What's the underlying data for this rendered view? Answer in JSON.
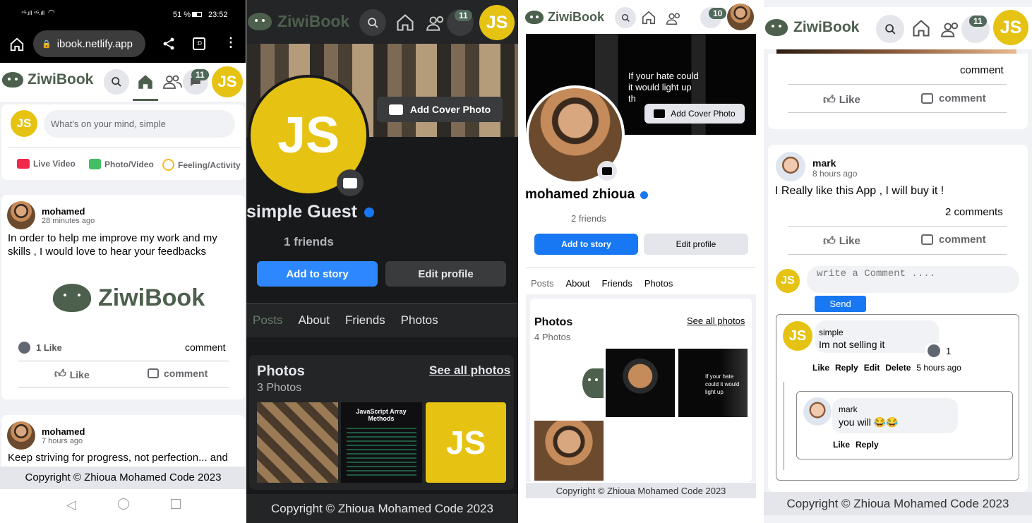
{
  "panel1": {
    "status": {
      "signal": "⁴ᴳ.ıll ⁴ᴳ.ıll",
      "battery": "51 %",
      "time": "23:52"
    },
    "browser": {
      "url": "ibook.netlify.app"
    },
    "nav": {
      "brand": "ZiwiBook",
      "badge": "11",
      "avatar": "JS"
    },
    "composer": {
      "avatar": "JS",
      "placeholder": "What's on your mind, simple",
      "live": "Live Video",
      "photo": "Photo/Video",
      "feeling": "Feeling/Activity"
    },
    "post1": {
      "author": "mohamed",
      "time": "28 minutes ago",
      "text": "In order to help me improve my work and my skills , I would love to hear your feedbacks",
      "image_brand": "ZiwiBook",
      "likes": "1 Like",
      "comment_link": "comment",
      "like_btn": "Like",
      "comment_btn": "comment"
    },
    "post2": {
      "author": "mohamed",
      "time": "7 hours ago",
      "text": "Keep striving for progress, not perfection... and"
    },
    "footer": "Copyright © Zhioua Mohamed Code 2023"
  },
  "panel2": {
    "nav": {
      "brand": "ZiwiBook",
      "badge": "11",
      "avatar": "JS"
    },
    "cover_btn": "Add Cover Photo",
    "profile_avatar": "JS",
    "name": "simple Guest",
    "friends": "1 friends",
    "add_story": "Add to story",
    "edit_profile": "Edit profile",
    "tabs": [
      "Posts",
      "About",
      "Friends",
      "Photos"
    ],
    "photos": {
      "title": "Photos",
      "count": "3 Photos",
      "see_all": "See all photos",
      "js_thumb": "JS",
      "code_title": "JavaScript Array Methods"
    },
    "footer": "Copyright © Zhioua Mohamed Code 2023"
  },
  "panel3": {
    "nav": {
      "brand": "ZiwiBook",
      "badge": "10"
    },
    "cover_btn": "Add Cover Photo",
    "cover_quote": "If your hate could it would light up th",
    "name": "mohamed zhioua",
    "friends": "2 friends",
    "add_story": "Add to story",
    "edit_profile": "Edit profile",
    "tabs": [
      "Posts",
      "About",
      "Friends",
      "Photos"
    ],
    "photos": {
      "title": "Photos",
      "count": "4 Photos",
      "see_all": "See all photos",
      "quote": "If your hate could it would light up"
    },
    "footer": "Copyright © Zhioua Mohamed Code 2023"
  },
  "panel4": {
    "nav": {
      "brand": "ZiwiBook",
      "badge": "11",
      "avatar": "JS"
    },
    "prev": {
      "comment_link": "comment",
      "like_btn": "Like",
      "comment_btn": "comment"
    },
    "post": {
      "author": "mark",
      "time": "8 hours ago",
      "text": "I Really like this App , I will buy it !",
      "comments_count": "2 comments",
      "like_btn": "Like",
      "comment_btn": "comment"
    },
    "composer": {
      "avatar": "JS",
      "placeholder": "write a Comment ....",
      "send": "Send"
    },
    "comment1": {
      "author": "simple",
      "avatar": "JS",
      "text": "Im not selling it",
      "likes": "1",
      "actions": [
        "Like",
        "Reply",
        "Edit",
        "Delete"
      ],
      "time": "5 hours ago"
    },
    "reply1": {
      "author": "mark",
      "text": "you will 😂😂",
      "actions": [
        "Like",
        "Reply"
      ]
    },
    "footer": "Copyright © Zhioua Mohamed Code 2023"
  },
  "colors": {
    "brand": "#4d5f4d",
    "blue": "#1877f2",
    "yellow": "#e6c312",
    "dark": "#18191a"
  }
}
